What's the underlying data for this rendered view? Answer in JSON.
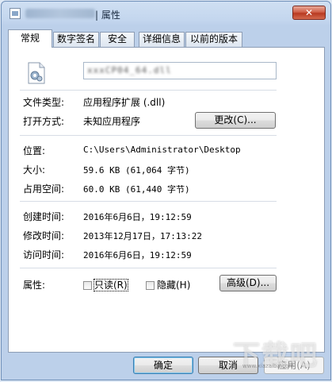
{
  "window": {
    "title_suffix": "| 属性",
    "close_glyph": "✕"
  },
  "tabs": [
    {
      "label": "常规",
      "active": true
    },
    {
      "label": "数字签名"
    },
    {
      "label": "安全"
    },
    {
      "label": "详细信息"
    },
    {
      "label": "以前的版本"
    }
  ],
  "general": {
    "file_name": "xxxCP04_64.dll",
    "file_type_label": "文件类型:",
    "file_type_value": "应用程序扩展 (.dll)",
    "open_with_label": "打开方式:",
    "open_with_value": "未知应用程序",
    "change_button": "更改(C)...",
    "location_label": "位置:",
    "location_value": "C:\\Users\\Administrator\\Desktop",
    "size_label": "大小:",
    "size_value": "59.6 KB (61,064 字节)",
    "size_on_disk_label": "占用空间:",
    "size_on_disk_value": "60.0 KB (61,440 字节)",
    "created_label": "创建时间:",
    "created_value": "2016年6月6日，19:12:59",
    "modified_label": "修改时间:",
    "modified_value": "2013年12月17日，17:13:22",
    "accessed_label": "访问时间:",
    "accessed_value": "2016年6月6日，19:12:59",
    "attributes_label": "属性:",
    "readonly_label": "只读(R)",
    "hidden_label": "隐藏(H)",
    "advanced_button": "高级(D)..."
  },
  "footer": {
    "ok": "确定",
    "cancel": "取消",
    "apply": "应用(A)"
  },
  "watermark": {
    "text": "下载吧",
    "sub": "www.xiazaiba.com"
  }
}
